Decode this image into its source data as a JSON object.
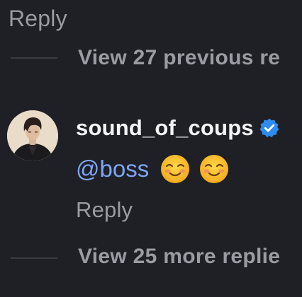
{
  "thread": {
    "reply_label_top": "Reply",
    "view_previous_label": "View 27 previous re",
    "view_more_label": "View 25 more replie"
  },
  "comment": {
    "username": "sound_of_coups",
    "verified": true,
    "mention": "@boss",
    "emojis": [
      "smiling-face-icon",
      "smiling-face-icon"
    ],
    "reply_label": "Reply"
  },
  "colors": {
    "background": "#1f2025",
    "muted_text": "#9a9ca3",
    "username_text": "#f4f4f6",
    "mention_blue": "#7ea5f5",
    "verified_blue": "#2e8bf0",
    "thread_line": "#3a3c43"
  }
}
